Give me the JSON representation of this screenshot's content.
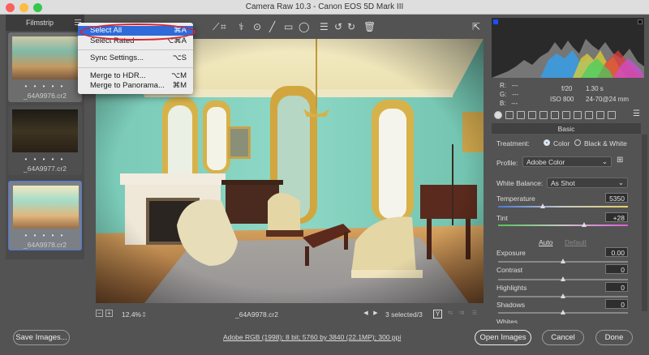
{
  "window": {
    "title": "Camera Raw 10.3  -  Canon EOS 5D Mark III"
  },
  "filmstrip": {
    "title": "Filmstrip",
    "items": [
      {
        "stars": "• • • • •",
        "filename": "_64A9976.cr2"
      },
      {
        "stars": "• • • • •",
        "filename": "_64A9977.cr2"
      },
      {
        "stars": "• • • • •",
        "filename": "_64A9978.cr2"
      }
    ]
  },
  "menu": {
    "items": [
      {
        "label": "Select All",
        "shortcut": "⌘A"
      },
      {
        "label": "Select Rated",
        "shortcut": "⌥⌘A"
      },
      {
        "label": "Sync Settings...",
        "shortcut": "⌥S"
      },
      {
        "label": "Merge to HDR...",
        "shortcut": "⌥M"
      },
      {
        "label": "Merge to Panorama...",
        "shortcut": "⌘M"
      }
    ]
  },
  "navigation": {
    "zoom_out": "−",
    "zoom_in": "+",
    "zoom": "12.4%",
    "filename": "_64A9978.cr2",
    "selection": "3 selected/3",
    "compare_label": "Y"
  },
  "readout": {
    "r_label": "R:",
    "r_value": "---",
    "g_label": "G:",
    "g_value": "---",
    "b_label": "B:",
    "b_value": "---",
    "aperture": "f/20",
    "shutter": "1.30 s",
    "iso": "ISO 800",
    "lens": "24-70@24 mm"
  },
  "panel": {
    "title": "Basic",
    "treatment_label": "Treatment:",
    "treatment_color": "Color",
    "treatment_bw": "Black & White",
    "profile_label": "Profile:",
    "profile_value": "Adobe Color",
    "wb_label": "White Balance:",
    "wb_value": "As Shot",
    "temperature_label": "Temperature",
    "temperature_value": "5350",
    "tint_label": "Tint",
    "tint_value": "+28",
    "auto_label": "Auto",
    "default_label": "Default",
    "exposure_label": "Exposure",
    "exposure_value": "0.00",
    "contrast_label": "Contrast",
    "contrast_value": "0",
    "highlights_label": "Highlights",
    "highlights_value": "0",
    "shadows_label": "Shadows",
    "shadows_value": "0",
    "whites_label": "Whites"
  },
  "footer": {
    "save_label": "Save Images...",
    "workflow_link": "Adobe RGB (1998); 8 bit; 5760 by 3840 (22.1MP); 300 ppi",
    "open_label": "Open Images",
    "cancel_label": "Cancel",
    "done_label": "Done"
  },
  "colors": {
    "accent": "#2f6bd8",
    "annotation": "#d8232f"
  }
}
